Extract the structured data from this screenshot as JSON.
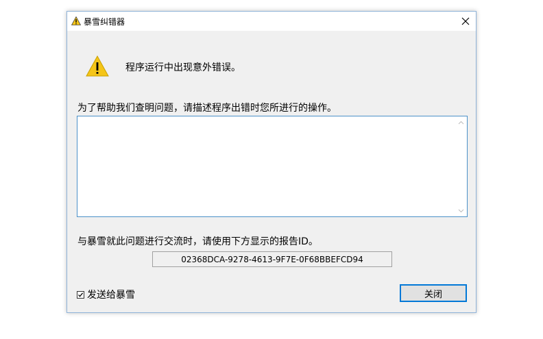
{
  "window": {
    "title": "暴雪纠错器",
    "title_icon": "warning-icon",
    "close_icon": "close-icon"
  },
  "message": "程序运行中出现意外错误。",
  "prompt": "为了帮助我们查明问题，请描述程序出错时您所进行的操作。",
  "description": {
    "value": "",
    "placeholder": ""
  },
  "report": {
    "label": "与暴雪就此问题进行交流时，请使用下方显示的报告ID。",
    "id": "02368DCA-9278-4613-9F7E-0F68BBEFCD94"
  },
  "send": {
    "label": "发送给暴雪",
    "checked": true
  },
  "close_button": "关闭",
  "colors": {
    "accent": "#0078d7",
    "warning": "#f5c518",
    "border": "#4a90c8"
  }
}
